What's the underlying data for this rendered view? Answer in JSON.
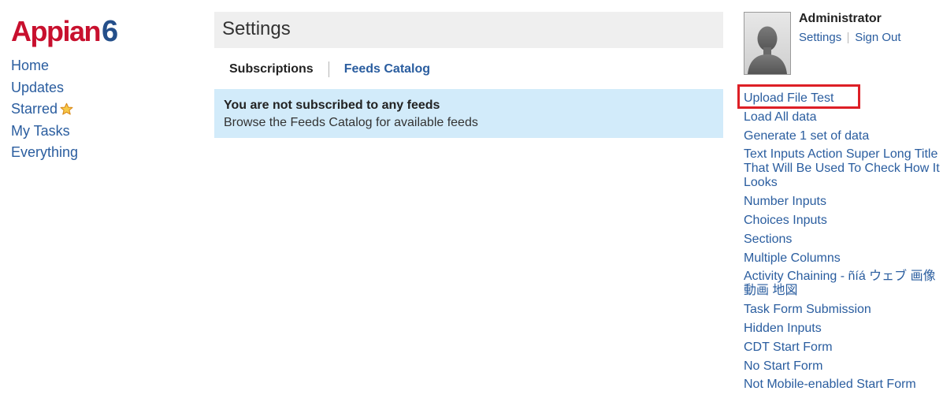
{
  "logo": {
    "text": "Appian",
    "version": "6"
  },
  "nav": [
    {
      "label": "Home"
    },
    {
      "label": "Updates"
    },
    {
      "label": "Starred"
    },
    {
      "label": "My Tasks"
    },
    {
      "label": "Everything"
    }
  ],
  "header": {
    "title": "Settings"
  },
  "tabs": [
    {
      "label": "Subscriptions"
    },
    {
      "label": "Feeds Catalog"
    }
  ],
  "notice": {
    "title": "You are not subscribed to any feeds",
    "body": "Browse the Feeds Catalog for available feeds"
  },
  "user": {
    "name": "Administrator",
    "settings_label": "Settings",
    "signout_label": "Sign Out"
  },
  "actions": [
    {
      "label": "Upload File Test"
    },
    {
      "label": "Load All data"
    },
    {
      "label": "Generate 1 set of data"
    },
    {
      "label": "Text Inputs Action Super Long Title That Will Be Used To Check How It Looks"
    },
    {
      "label": "Number Inputs"
    },
    {
      "label": "Choices Inputs"
    },
    {
      "label": "Sections"
    },
    {
      "label": "Multiple Columns"
    },
    {
      "label": "Activity Chaining - ñíá ウェブ 画像 動画 地図"
    },
    {
      "label": "Task Form Submission"
    },
    {
      "label": "Hidden Inputs"
    },
    {
      "label": "CDT Start Form"
    },
    {
      "label": "No Start Form"
    },
    {
      "label": "Not Mobile-enabled Start Form"
    }
  ],
  "colors": {
    "brand_red": "#c8102e",
    "brand_blue": "#244f8a",
    "link": "#2a5d9f",
    "notice_bg": "#d2ebfa",
    "header_bg": "#efefef",
    "highlight": "#dd1f26"
  }
}
